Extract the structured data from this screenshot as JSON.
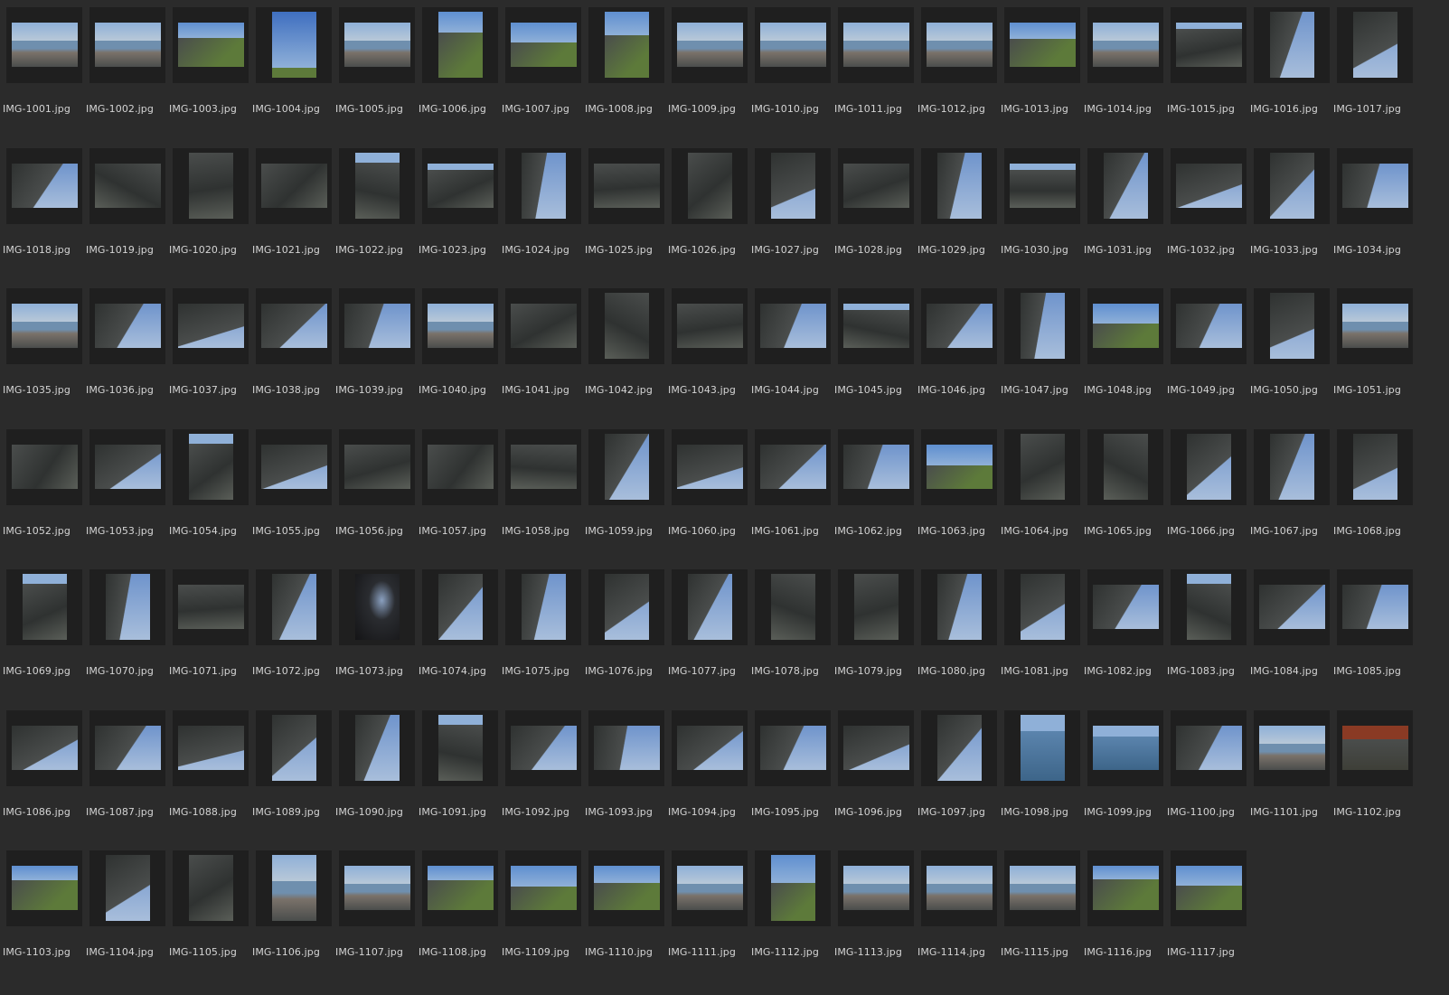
{
  "files": [
    {
      "name": "IMG-1001.jpg",
      "orient": "land",
      "scene": "coast"
    },
    {
      "name": "IMG-1002.jpg",
      "orient": "land",
      "scene": "coast"
    },
    {
      "name": "IMG-1003.jpg",
      "orient": "land",
      "scene": "grass"
    },
    {
      "name": "IMG-1004.jpg",
      "orient": "port",
      "scene": "sky"
    },
    {
      "name": "IMG-1005.jpg",
      "orient": "land",
      "scene": "coast"
    },
    {
      "name": "IMG-1006.jpg",
      "orient": "port",
      "scene": "grass"
    },
    {
      "name": "IMG-1007.jpg",
      "orient": "land",
      "scene": "grass"
    },
    {
      "name": "IMG-1008.jpg",
      "orient": "port",
      "scene": "grass"
    },
    {
      "name": "IMG-1009.jpg",
      "orient": "land",
      "scene": "coast"
    },
    {
      "name": "IMG-1010.jpg",
      "orient": "land",
      "scene": "coast"
    },
    {
      "name": "IMG-1011.jpg",
      "orient": "land",
      "scene": "coast"
    },
    {
      "name": "IMG-1012.jpg",
      "orient": "land",
      "scene": "coast"
    },
    {
      "name": "IMG-1013.jpg",
      "orient": "land",
      "scene": "grass"
    },
    {
      "name": "IMG-1014.jpg",
      "orient": "land",
      "scene": "coast"
    },
    {
      "name": "IMG-1015.jpg",
      "orient": "land",
      "scene": "rock"
    },
    {
      "name": "IMG-1016.jpg",
      "orient": "port",
      "scene": "cliff"
    },
    {
      "name": "IMG-1017.jpg",
      "orient": "port",
      "scene": "cliff"
    },
    {
      "name": "IMG-1018.jpg",
      "orient": "land",
      "scene": "cliff"
    },
    {
      "name": "IMG-1019.jpg",
      "orient": "land",
      "scene": "rock"
    },
    {
      "name": "IMG-1020.jpg",
      "orient": "port",
      "scene": "rock"
    },
    {
      "name": "IMG-1021.jpg",
      "orient": "land",
      "scene": "rock"
    },
    {
      "name": "IMG-1022.jpg",
      "orient": "port",
      "scene": "rock"
    },
    {
      "name": "IMG-1023.jpg",
      "orient": "land",
      "scene": "rock"
    },
    {
      "name": "IMG-1024.jpg",
      "orient": "port",
      "scene": "cliff"
    },
    {
      "name": "IMG-1025.jpg",
      "orient": "land",
      "scene": "rock"
    },
    {
      "name": "IMG-1026.jpg",
      "orient": "port",
      "scene": "rock"
    },
    {
      "name": "IMG-1027.jpg",
      "orient": "port",
      "scene": "cliff"
    },
    {
      "name": "IMG-1028.jpg",
      "orient": "land",
      "scene": "rock"
    },
    {
      "name": "IMG-1029.jpg",
      "orient": "port",
      "scene": "cliff"
    },
    {
      "name": "IMG-1030.jpg",
      "orient": "land",
      "scene": "rock"
    },
    {
      "name": "IMG-1031.jpg",
      "orient": "port",
      "scene": "cliff"
    },
    {
      "name": "IMG-1032.jpg",
      "orient": "land",
      "scene": "cliff"
    },
    {
      "name": "IMG-1033.jpg",
      "orient": "port",
      "scene": "cliff"
    },
    {
      "name": "IMG-1034.jpg",
      "orient": "land",
      "scene": "cliff"
    },
    {
      "name": "IMG-1035.jpg",
      "orient": "land",
      "scene": "coast"
    },
    {
      "name": "IMG-1036.jpg",
      "orient": "land",
      "scene": "cliff"
    },
    {
      "name": "IMG-1037.jpg",
      "orient": "land",
      "scene": "cliff"
    },
    {
      "name": "IMG-1038.jpg",
      "orient": "land",
      "scene": "cliff"
    },
    {
      "name": "IMG-1039.jpg",
      "orient": "land",
      "scene": "cliff"
    },
    {
      "name": "IMG-1040.jpg",
      "orient": "land",
      "scene": "coast"
    },
    {
      "name": "IMG-1041.jpg",
      "orient": "land",
      "scene": "rock"
    },
    {
      "name": "IMG-1042.jpg",
      "orient": "port",
      "scene": "rock"
    },
    {
      "name": "IMG-1043.jpg",
      "orient": "land",
      "scene": "rock"
    },
    {
      "name": "IMG-1044.jpg",
      "orient": "land",
      "scene": "cliff"
    },
    {
      "name": "IMG-1045.jpg",
      "orient": "land",
      "scene": "rock"
    },
    {
      "name": "IMG-1046.jpg",
      "orient": "land",
      "scene": "cliff"
    },
    {
      "name": "IMG-1047.jpg",
      "orient": "port",
      "scene": "cliff"
    },
    {
      "name": "IMG-1048.jpg",
      "orient": "land",
      "scene": "grass"
    },
    {
      "name": "IMG-1049.jpg",
      "orient": "land",
      "scene": "cliff"
    },
    {
      "name": "IMG-1050.jpg",
      "orient": "port",
      "scene": "cliff"
    },
    {
      "name": "IMG-1051.jpg",
      "orient": "land",
      "scene": "coast"
    },
    {
      "name": "IMG-1052.jpg",
      "orient": "land",
      "scene": "rock"
    },
    {
      "name": "IMG-1053.jpg",
      "orient": "land",
      "scene": "cliff"
    },
    {
      "name": "IMG-1054.jpg",
      "orient": "port",
      "scene": "rock"
    },
    {
      "name": "IMG-1055.jpg",
      "orient": "land",
      "scene": "cliff"
    },
    {
      "name": "IMG-1056.jpg",
      "orient": "land",
      "scene": "rock"
    },
    {
      "name": "IMG-1057.jpg",
      "orient": "land",
      "scene": "rock"
    },
    {
      "name": "IMG-1058.jpg",
      "orient": "land",
      "scene": "rock"
    },
    {
      "name": "IMG-1059.jpg",
      "orient": "port",
      "scene": "cliff"
    },
    {
      "name": "IMG-1060.jpg",
      "orient": "land",
      "scene": "cliff"
    },
    {
      "name": "IMG-1061.jpg",
      "orient": "land",
      "scene": "cliff"
    },
    {
      "name": "IMG-1062.jpg",
      "orient": "land",
      "scene": "cliff"
    },
    {
      "name": "IMG-1063.jpg",
      "orient": "land",
      "scene": "grass"
    },
    {
      "name": "IMG-1064.jpg",
      "orient": "port",
      "scene": "rock"
    },
    {
      "name": "IMG-1065.jpg",
      "orient": "port",
      "scene": "rock"
    },
    {
      "name": "IMG-1066.jpg",
      "orient": "port",
      "scene": "cliff"
    },
    {
      "name": "IMG-1067.jpg",
      "orient": "port",
      "scene": "cliff"
    },
    {
      "name": "IMG-1068.jpg",
      "orient": "port",
      "scene": "cliff"
    },
    {
      "name": "IMG-1069.jpg",
      "orient": "port",
      "scene": "rock"
    },
    {
      "name": "IMG-1070.jpg",
      "orient": "port",
      "scene": "cliff"
    },
    {
      "name": "IMG-1071.jpg",
      "orient": "land",
      "scene": "rock"
    },
    {
      "name": "IMG-1072.jpg",
      "orient": "port",
      "scene": "cliff"
    },
    {
      "name": "IMG-1073.jpg",
      "orient": "port",
      "scene": "cave"
    },
    {
      "name": "IMG-1074.jpg",
      "orient": "port",
      "scene": "cliff"
    },
    {
      "name": "IMG-1075.jpg",
      "orient": "port",
      "scene": "cliff"
    },
    {
      "name": "IMG-1076.jpg",
      "orient": "port",
      "scene": "cliff"
    },
    {
      "name": "IMG-1077.jpg",
      "orient": "port",
      "scene": "cliff"
    },
    {
      "name": "IMG-1078.jpg",
      "orient": "port",
      "scene": "rock"
    },
    {
      "name": "IMG-1079.jpg",
      "orient": "port",
      "scene": "rock"
    },
    {
      "name": "IMG-1080.jpg",
      "orient": "port",
      "scene": "cliff"
    },
    {
      "name": "IMG-1081.jpg",
      "orient": "port",
      "scene": "cliff"
    },
    {
      "name": "IMG-1082.jpg",
      "orient": "land",
      "scene": "cliff"
    },
    {
      "name": "IMG-1083.jpg",
      "orient": "port",
      "scene": "rock"
    },
    {
      "name": "IMG-1084.jpg",
      "orient": "land",
      "scene": "cliff"
    },
    {
      "name": "IMG-1085.jpg",
      "orient": "land",
      "scene": "cliff"
    },
    {
      "name": "IMG-1086.jpg",
      "orient": "land",
      "scene": "cliff"
    },
    {
      "name": "IMG-1087.jpg",
      "orient": "land",
      "scene": "cliff"
    },
    {
      "name": "IMG-1088.jpg",
      "orient": "land",
      "scene": "cliff"
    },
    {
      "name": "IMG-1089.jpg",
      "orient": "port",
      "scene": "cliff"
    },
    {
      "name": "IMG-1090.jpg",
      "orient": "port",
      "scene": "cliff"
    },
    {
      "name": "IMG-1091.jpg",
      "orient": "port",
      "scene": "rock"
    },
    {
      "name": "IMG-1092.jpg",
      "orient": "land",
      "scene": "cliff"
    },
    {
      "name": "IMG-1093.jpg",
      "orient": "land",
      "scene": "cliff"
    },
    {
      "name": "IMG-1094.jpg",
      "orient": "land",
      "scene": "cliff"
    },
    {
      "name": "IMG-1095.jpg",
      "orient": "land",
      "scene": "cliff"
    },
    {
      "name": "IMG-1096.jpg",
      "orient": "land",
      "scene": "cliff"
    },
    {
      "name": "IMG-1097.jpg",
      "orient": "port",
      "scene": "cliff"
    },
    {
      "name": "IMG-1098.jpg",
      "orient": "port",
      "scene": "water"
    },
    {
      "name": "IMG-1099.jpg",
      "orient": "land",
      "scene": "water"
    },
    {
      "name": "IMG-1100.jpg",
      "orient": "land",
      "scene": "cliff"
    },
    {
      "name": "IMG-1101.jpg",
      "orient": "land",
      "scene": "coast"
    },
    {
      "name": "IMG-1102.jpg",
      "orient": "land",
      "scene": "red"
    },
    {
      "name": "IMG-1103.jpg",
      "orient": "land",
      "scene": "grass"
    },
    {
      "name": "IMG-1104.jpg",
      "orient": "port",
      "scene": "cliff"
    },
    {
      "name": "IMG-1105.jpg",
      "orient": "port",
      "scene": "rock"
    },
    {
      "name": "IMG-1106.jpg",
      "orient": "port",
      "scene": "coast"
    },
    {
      "name": "IMG-1107.jpg",
      "orient": "land",
      "scene": "coast"
    },
    {
      "name": "IMG-1108.jpg",
      "orient": "land",
      "scene": "grass"
    },
    {
      "name": "IMG-1109.jpg",
      "orient": "land",
      "scene": "grass"
    },
    {
      "name": "IMG-1110.jpg",
      "orient": "land",
      "scene": "grass"
    },
    {
      "name": "IMG-1111.jpg",
      "orient": "land",
      "scene": "coast"
    },
    {
      "name": "IMG-1112.jpg",
      "orient": "port",
      "scene": "grass"
    },
    {
      "name": "IMG-1113.jpg",
      "orient": "land",
      "scene": "coast"
    },
    {
      "name": "IMG-1114.jpg",
      "orient": "land",
      "scene": "coast"
    },
    {
      "name": "IMG-1115.jpg",
      "orient": "land",
      "scene": "coast"
    },
    {
      "name": "IMG-1116.jpg",
      "orient": "land",
      "scene": "grass"
    },
    {
      "name": "IMG-1117.jpg",
      "orient": "land",
      "scene": "grass"
    }
  ],
  "colors": {
    "background": "#2b2b2b",
    "thumb_box": "#1f1f1f",
    "label_text": "#d4d4d4",
    "sky": "#8fb0d8",
    "sea": "#6f8fae",
    "rock": "#4a4d4c",
    "rock_dark": "#2f3231",
    "grass": "#5d7a3a",
    "red": "#8a3a24"
  }
}
